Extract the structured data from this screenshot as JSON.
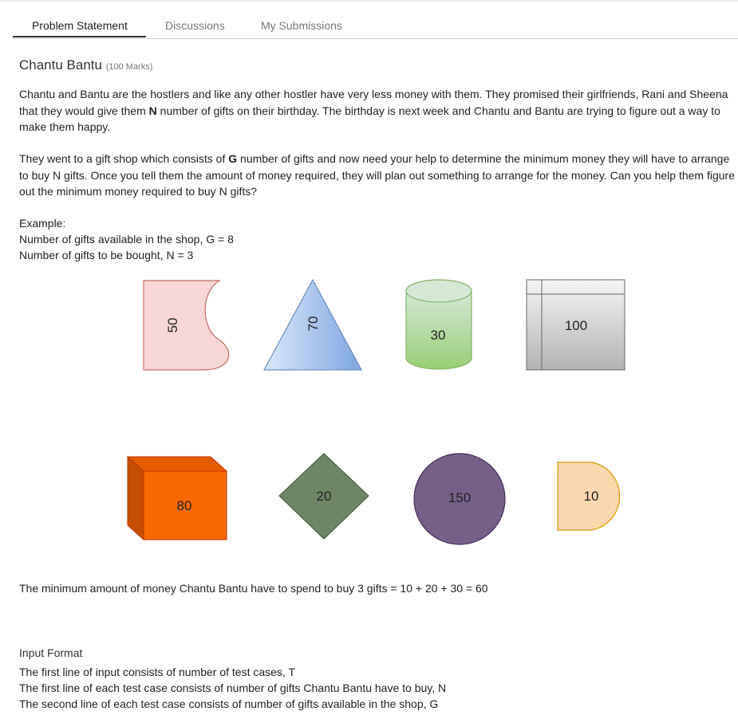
{
  "tabs": [
    {
      "label": "Problem Statement",
      "active": true
    },
    {
      "label": "Discussions",
      "active": false
    },
    {
      "label": "My Submissions",
      "active": false
    }
  ],
  "problem": {
    "title": "Chantu Bantu",
    "marks": "(100 Marks)",
    "para1": {
      "before_n": "Chantu and Bantu are the hostlers and like any other hostler have very less money with them. They promised their girlfriends, Rani and Sheena that they would give them ",
      "n": "N",
      "after_n": " number of gifts on their birthday. The birthday is next week and Chantu and Bantu are trying to figure out a way to make them happy."
    },
    "para2": {
      "before_g": "They went to a gift shop which consists of ",
      "g": "G",
      "after_g": " number of gifts and now need your help to determine the minimum money they will have to arrange to buy N gifts. Once you tell them the amount of money required, they will plan out something to arrange for the money. Can you help them figure out the minimum money required to buy N gifts?"
    },
    "example": {
      "label": "Example:",
      "line1": "Number of gifts available in the shop, G = 8",
      "line2": "Number of gifts to be bought, N = 3"
    },
    "gifts": [
      {
        "value": "50",
        "shape": "card-shape",
        "fill": "#f8d7d6",
        "stroke": "#c96b67"
      },
      {
        "value": "70",
        "shape": "triangle",
        "fill": "#8fb3ea",
        "stroke": "#6c8ebf"
      },
      {
        "value": "30",
        "shape": "cylinder",
        "fill": "#b5df98",
        "stroke": "#82b366"
      },
      {
        "value": "100",
        "shape": "window-box",
        "fill": "#d4d4d4",
        "stroke": "#666666"
      },
      {
        "value": "80",
        "shape": "cube",
        "fill": "#fa6800",
        "stroke": "#c73500"
      },
      {
        "value": "20",
        "shape": "diamond",
        "fill": "#6d8764",
        "stroke": "#3a5431"
      },
      {
        "value": "150",
        "shape": "circle",
        "fill": "#76608a",
        "stroke": "#432d57"
      },
      {
        "value": "10",
        "shape": "delay",
        "fill": "#fad7ac",
        "stroke": "#d79b00"
      }
    ],
    "result": "The minimum amount of money Chantu Bantu have to spend to buy 3 gifts = 10 + 20 + 30 = 60",
    "input_format": {
      "heading": "Input Format",
      "lines": [
        "The first line of input consists of number of test cases, T",
        "The first line of each test case consists of number of gifts Chantu Bantu have to buy, N",
        "The second line of each test case consists of number of gifts available in the shop, G"
      ]
    }
  }
}
